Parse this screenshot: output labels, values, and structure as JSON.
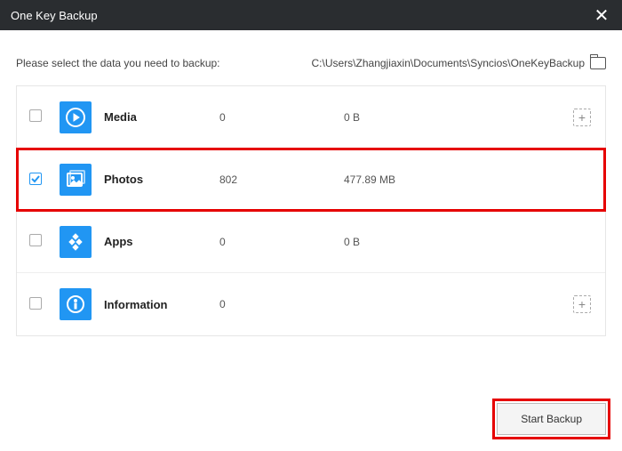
{
  "window": {
    "title": "One Key Backup"
  },
  "header": {
    "prompt": "Please select the data you need to backup:",
    "path": "C:\\Users\\Zhangjiaxin\\Documents\\Syncios\\OneKeyBackup"
  },
  "rows": [
    {
      "label": "Media",
      "count": "0",
      "size": "0 B",
      "checked": false,
      "selected": false,
      "expandable": true,
      "icon": "play"
    },
    {
      "label": "Photos",
      "count": "802",
      "size": "477.89 MB",
      "checked": true,
      "selected": true,
      "expandable": false,
      "icon": "photo"
    },
    {
      "label": "Apps",
      "count": "0",
      "size": "0 B",
      "checked": false,
      "selected": false,
      "expandable": false,
      "icon": "apps"
    },
    {
      "label": "Information",
      "count": "0",
      "size": "",
      "checked": false,
      "selected": false,
      "expandable": true,
      "icon": "info"
    }
  ],
  "footer": {
    "start_label": "Start Backup"
  }
}
